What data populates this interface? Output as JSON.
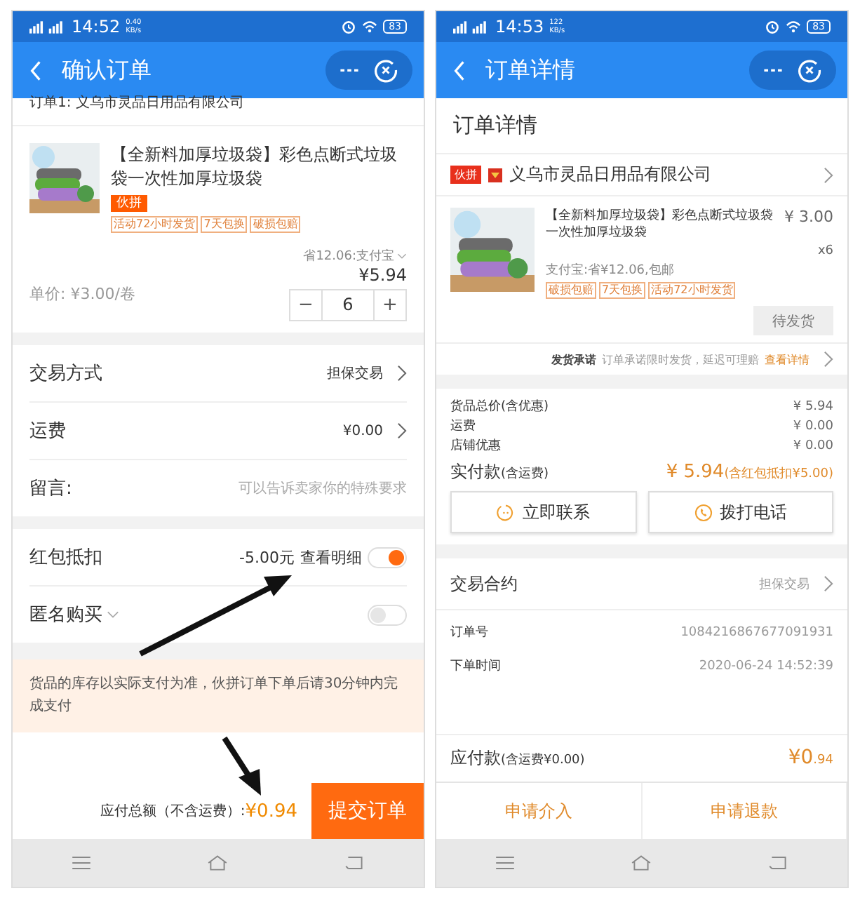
{
  "confirm_screen": {
    "status_bar": {
      "time": "14:52",
      "speed": "0.40",
      "speed_unit": "KB/s",
      "battery": "83"
    },
    "nav": {
      "title": "确认订单"
    },
    "order_title": "订单1: 义乌市灵品日用品有限公司",
    "product": {
      "title": "【全新料加厚垃圾袋】彩色点断式垃圾袋一次性加厚垃圾袋",
      "badge": "伙拼",
      "tags": [
        "活动72小时发货",
        "7天包换",
        "破损包赔"
      ],
      "saving": "省12.06:支付宝",
      "unit_price": "单价: ¥3.00/卷",
      "total": "¥5.94",
      "minus": "−",
      "quantity": "6",
      "plus": "+"
    },
    "rows": [
      {
        "kind": "link",
        "label": "交易方式",
        "value": "担保交易"
      },
      {
        "kind": "link",
        "label": "运费",
        "value": "¥0.00"
      },
      {
        "kind": "input",
        "label": "留言:",
        "placeholder": "可以告诉卖家你的特殊要求"
      }
    ],
    "options": [
      {
        "kind": "toggle",
        "label": "红包抵扣",
        "value": "-5.00元",
        "link": "查看明细",
        "on": true,
        "caret": false
      },
      {
        "kind": "toggle",
        "label": "匿名购买",
        "on": false,
        "caret": true
      }
    ],
    "notice": "货品的库存以实际支付为准，伙拼订单下单后请30分钟内完成支付",
    "footer": {
      "label": "应付总额（不含运费）:",
      "amount": "¥0.94",
      "button": "提交订单"
    }
  },
  "detail_screen": {
    "status_bar": {
      "time": "14:53",
      "speed": "122",
      "speed_unit": "KB/s",
      "battery": "83"
    },
    "nav": {
      "title": "订单详情"
    },
    "heading": "订单详情",
    "seller": {
      "badge": "伙拼",
      "name": "义乌市灵品日用品有限公司"
    },
    "product": {
      "title": "【全新料加厚垃圾袋】彩色点断式垃圾袋一次性加厚垃圾袋",
      "price": "¥ 3.00",
      "count": "x6",
      "promo": "支付宝:省¥12.06,包邮",
      "tags": [
        "破损包赔",
        "7天包换",
        "活动72小时发货"
      ],
      "status": "待发货"
    },
    "promise": {
      "label": "发货承诺",
      "text": "订单承诺限时发货，延迟可理赔",
      "link": "查看详情"
    },
    "price_lines": [
      {
        "label": "货品总价(含优惠)",
        "value": "¥ 5.94"
      },
      {
        "label": "运费",
        "value": "¥ 0.00"
      },
      {
        "label": "店铺优惠",
        "value": "¥ 0.00"
      }
    ],
    "paid": {
      "label": "实付款",
      "sub": "(含运费)",
      "amount": "¥ 5.94",
      "note": "(含红包抵扣¥5.00)"
    },
    "contact_buttons": [
      {
        "kind": "chat",
        "label": "立即联系"
      },
      {
        "kind": "phone",
        "label": "拨打电话"
      }
    ],
    "contract": {
      "label": "交易合约",
      "value": "担保交易"
    },
    "info": [
      {
        "label": "订单号",
        "value": "1084216867677091931"
      },
      {
        "label": "下单时间",
        "value": "2020-06-24 14:52:39"
      }
    ],
    "footer": {
      "label": "应付款",
      "sub": "(含运费¥0.00)",
      "amount_main": "¥0",
      "amount_cents": ".94"
    },
    "actions": [
      "申请介入",
      "申请退款"
    ]
  }
}
